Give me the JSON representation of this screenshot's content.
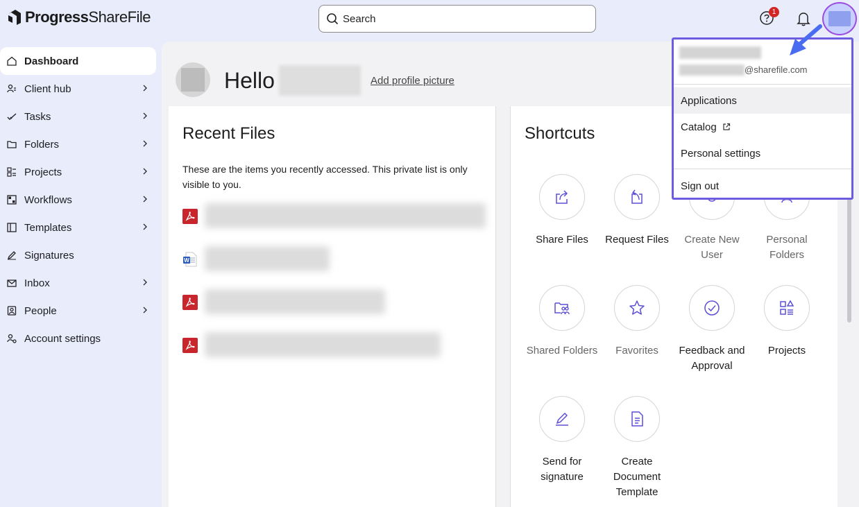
{
  "brand": {
    "name_bold": "Progress",
    "name_regular": "ShareFile"
  },
  "header": {
    "search_label": "Search",
    "help_badge_count": "1"
  },
  "sidebar": {
    "items": [
      {
        "label": "Dashboard",
        "icon": "home-icon",
        "active": true,
        "chevron": false
      },
      {
        "label": "Client hub",
        "icon": "client-hub-icon",
        "chevron": true
      },
      {
        "label": "Tasks",
        "icon": "check-icon",
        "chevron": true
      },
      {
        "label": "Folders",
        "icon": "folder-icon",
        "chevron": true
      },
      {
        "label": "Projects",
        "icon": "projects-icon",
        "chevron": true
      },
      {
        "label": "Workflows",
        "icon": "workflows-icon",
        "chevron": true
      },
      {
        "label": "Templates",
        "icon": "templates-icon",
        "chevron": true
      },
      {
        "label": "Signatures",
        "icon": "pen-icon",
        "chevron": false
      },
      {
        "label": "Inbox",
        "icon": "mail-icon",
        "chevron": true
      },
      {
        "label": "People",
        "icon": "people-icon",
        "chevron": true
      },
      {
        "label": "Account settings",
        "icon": "account-settings-icon",
        "chevron": false
      }
    ]
  },
  "greeting": {
    "hello": "Hello",
    "add_profile_picture": "Add profile picture"
  },
  "recent_files": {
    "title": "Recent Files",
    "description": "These are the items you recently accessed. This private list is only visible to you.",
    "files": [
      {
        "type": "pdf-icon"
      },
      {
        "type": "word-icon"
      },
      {
        "type": "pdf-icon"
      },
      {
        "type": "pdf-icon"
      }
    ]
  },
  "shortcuts": {
    "title": "Shortcuts",
    "items": [
      {
        "label": "Share Files",
        "icon": "share-icon",
        "dim": false
      },
      {
        "label": "Request Files",
        "icon": "request-icon",
        "dim": false
      },
      {
        "label": "Create New User",
        "icon": "add-user-icon",
        "dim": true
      },
      {
        "label": "Personal Folders",
        "icon": "person-icon",
        "dim": true
      },
      {
        "label": "Shared Folders",
        "icon": "shared-folder-icon",
        "dim": true
      },
      {
        "label": "Favorites",
        "icon": "star-icon",
        "dim": true
      },
      {
        "label": "Feedback and Approval",
        "icon": "check-circle-icon",
        "dim": false
      },
      {
        "label": "Projects",
        "icon": "projects-icon",
        "dim": false
      },
      {
        "label": "Send for signature",
        "icon": "pen-icon",
        "dim": false
      },
      {
        "label": "Create Document Template",
        "icon": "document-icon",
        "dim": false
      }
    ]
  },
  "user_menu": {
    "email_domain": "@sharefile.com",
    "items": [
      {
        "label": "Applications"
      },
      {
        "label": "Catalog"
      },
      {
        "label": "Personal settings"
      },
      {
        "label": "Sign out"
      }
    ]
  },
  "colors": {
    "accent": "#6b5ce0",
    "icon_purple": "#5b4fd6",
    "badge_red": "#d42525",
    "background": "#e8ecfb"
  }
}
